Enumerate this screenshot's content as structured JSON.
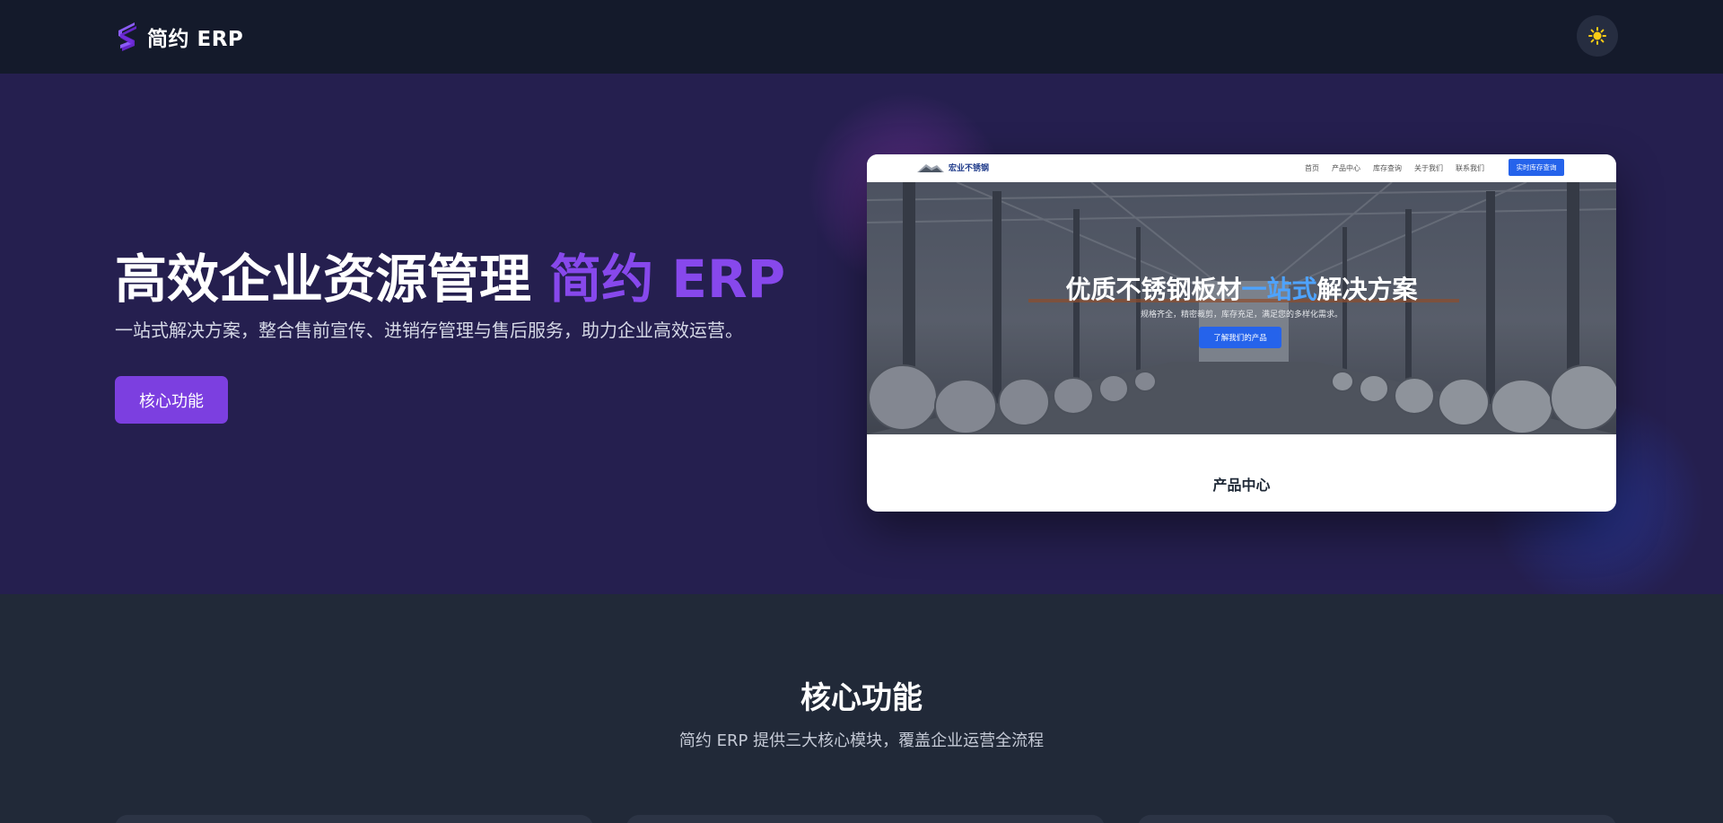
{
  "brand": {
    "name": "简约 ERP",
    "logo_icon": "s-logo-icon",
    "accent_color": "#7c3fe0"
  },
  "header": {
    "theme_toggle_icon": "sun-icon"
  },
  "hero": {
    "title_main": "高效企业资源管理 ",
    "title_accent": "简约 ERP",
    "subtitle": "一站式解决方案，整合售前宣传、进销存管理与售后服务，助力企业高效运营。",
    "cta_label": "核心功能"
  },
  "preview": {
    "brand_name": "宏业不锈钢",
    "menu": [
      "首页",
      "产品中心",
      "库存查询",
      "关于我们",
      "联系我们"
    ],
    "cta_label": "实时库存查询",
    "hero_title_a": "优质不锈钢板材",
    "hero_title_hl": "一站式",
    "hero_title_b": "解决方案",
    "hero_subtitle": "规格齐全，精密裁剪，库存充足，满足您的多样化需求。",
    "hero_button": "了解我们的产品",
    "section_title": "产品中心"
  },
  "features": {
    "title": "核心功能",
    "subtitle": "简约 ERP 提供三大核心模块，覆盖企业运营全流程"
  }
}
